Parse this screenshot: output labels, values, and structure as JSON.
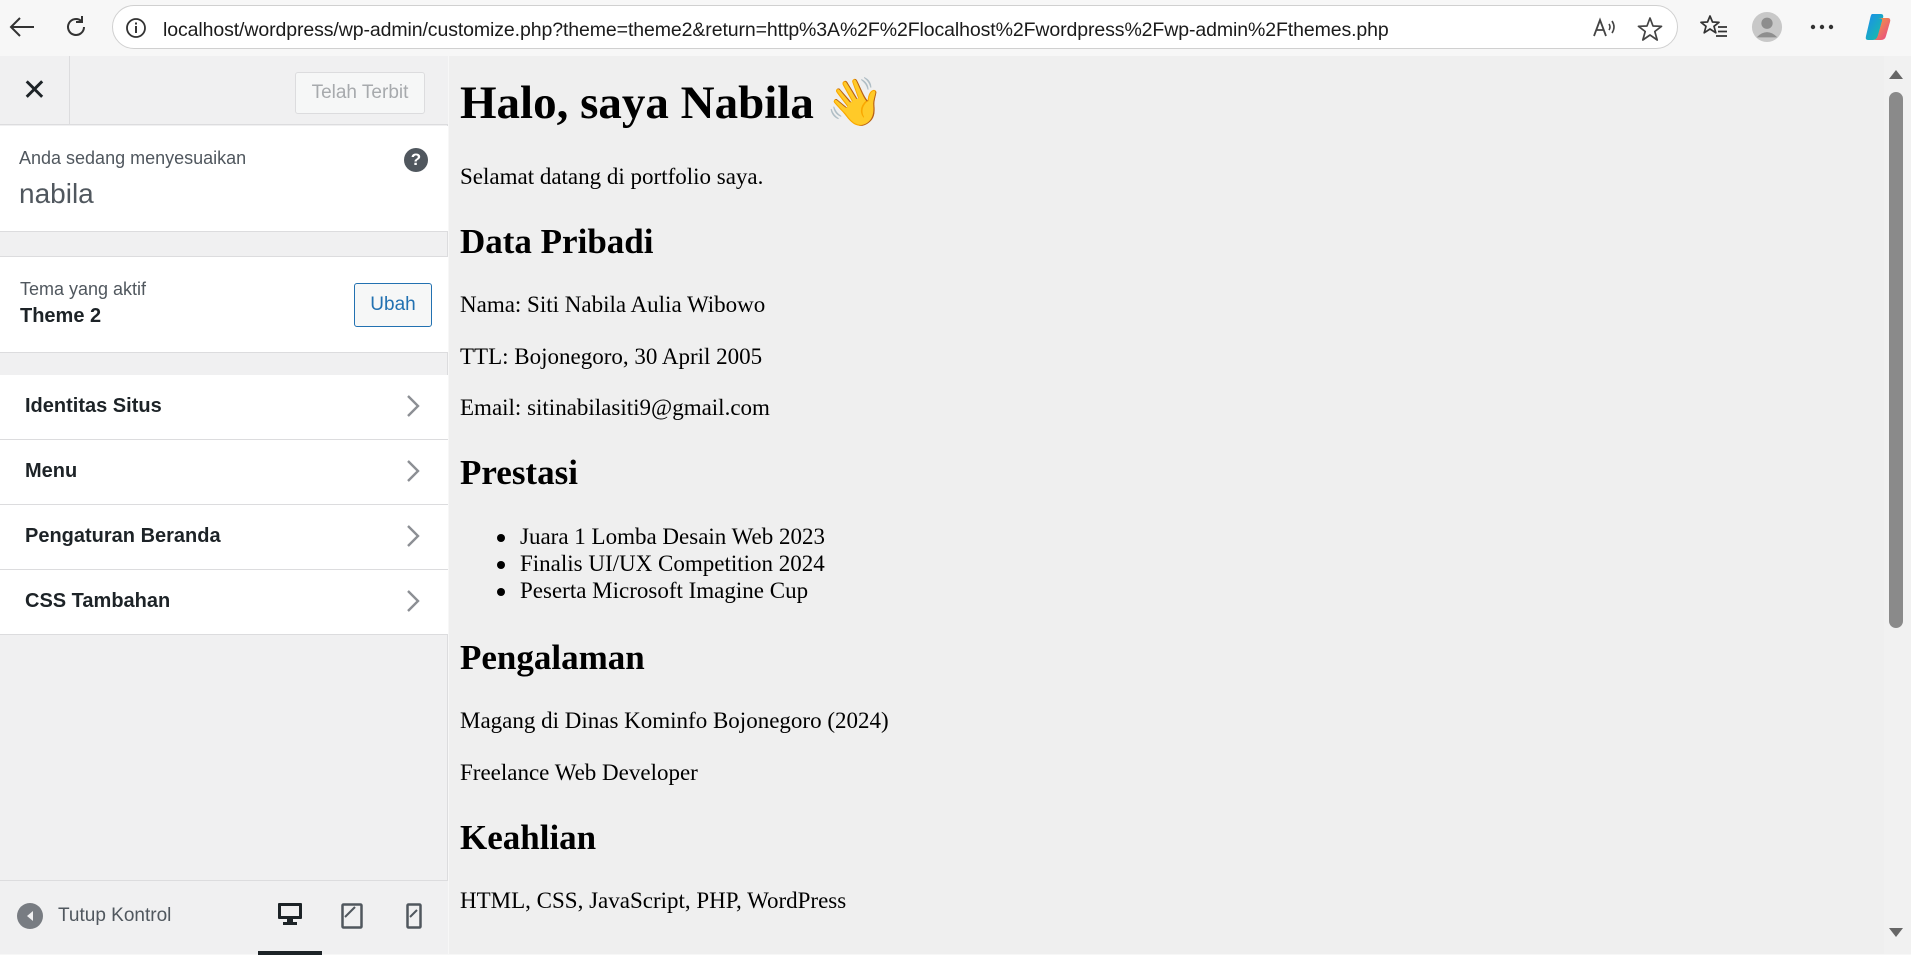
{
  "browser": {
    "url": "localhost/wordpress/wp-admin/customize.php?theme=theme2&return=http%3A%2F%2Flocalhost%2Fwordpress%2Fwp-admin%2Fthemes.php",
    "icons": [
      "back-icon",
      "refresh-icon",
      "site-info-icon",
      "read-aloud-icon",
      "favorite-star-icon",
      "favorites-list-icon",
      "profile-avatar-icon",
      "more-options-icon",
      "copilot-icon"
    ]
  },
  "sidebar": {
    "close_symbol": "✕",
    "publish_label": "Telah Terbit",
    "customizing_label": "Anda sedang menyesuaikan",
    "site_name": "nabila",
    "help_symbol": "?",
    "active_theme_label": "Tema yang aktif",
    "active_theme_name": "Theme 2",
    "change_label": "Ubah",
    "sections": [
      {
        "label": "Identitas Situs"
      },
      {
        "label": "Menu"
      },
      {
        "label": "Pengaturan Beranda"
      },
      {
        "label": "CSS Tambahan"
      }
    ],
    "collapse_label": "Tutup Kontrol",
    "devices": [
      "desktop",
      "tablet",
      "mobile"
    ]
  },
  "preview": {
    "heading": "Halo, saya Nabila 👋",
    "intro": "Selamat datang di portfolio saya.",
    "personal_heading": "Data Pribadi",
    "name_line": "Nama: Siti Nabila Aulia Wibowo",
    "birth_line": "TTL: Bojonegoro, 30 April 2005",
    "email_line": "Email: sitinabilasiti9@gmail.com",
    "achievements_heading": "Prestasi",
    "achievements": [
      "Juara 1 Lomba Desain Web 2023",
      "Finalis UI/UX Competition 2024",
      "Peserta Microsoft Imagine Cup"
    ],
    "experience_heading": "Pengalaman",
    "experience": [
      "Magang di Dinas Kominfo Bojonegoro (2024)",
      "Freelance Web Developer"
    ],
    "skills_heading": "Keahlian",
    "skills": "HTML, CSS, JavaScript, PHP, WordPress"
  },
  "colors": {
    "wp_blue": "#2271b1",
    "sidebar_bg": "#f0f0f1",
    "preview_bg": "#efefef"
  }
}
